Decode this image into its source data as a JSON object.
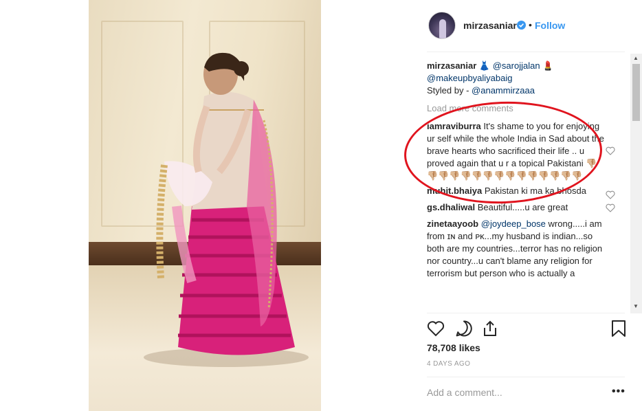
{
  "post": {
    "username": "mirzasaniar",
    "follow_label": "Follow",
    "dot": "•",
    "verified_icon": "verified-badge-icon",
    "accent_color": "#3897f0"
  },
  "caption": {
    "user": "mirzasaniar",
    "emoji_dress": "👗",
    "mention1": "@sarojjalan",
    "emoji_lipstick": "💄",
    "mention2": "@makeupbyaliyabaig",
    "styled_by": "Styled by - ",
    "mention3": "@anammirzaaa"
  },
  "load_more": "Load more comments",
  "comments": [
    {
      "user": "iamraviburra",
      "text": "It's shame to you for enjoying ur self while the whole India in Sad about the brave hearts who sacrificed their life .. u proved again that u r a topical Pakistani 👎🏼👎🏼👎🏼👎🏼👎🏼👎🏼👎🏼👎🏼👎🏼👎🏼👎🏼👎🏼👎🏼👎🏼👎🏼"
    },
    {
      "user": "muhit.bhaiya",
      "text": "Pakistan ki ma ka bhosda"
    },
    {
      "user": "gs.dhaliwal",
      "text": "Beautiful.....u are great"
    },
    {
      "user": "zinetaayoob",
      "mention": "@joydeep_bose",
      "text": "wrong.....i am from ɪɴ and ᴘᴋ...my husband is indian...so both are my countries...terror has no religion nor country...u can't blame any religion for terrorism but person who is actually a"
    }
  ],
  "likes": "78,708 likes",
  "timestamp": "4 DAYS AGO",
  "add_comment_placeholder": "Add a comment...",
  "more_label": "•••",
  "scroll": {
    "up": "▲",
    "down": "▼"
  },
  "annotation_color": "#e0141e"
}
